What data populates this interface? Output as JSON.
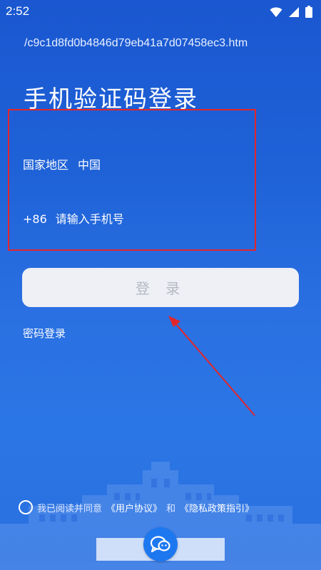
{
  "status_bar": {
    "time": "2:52",
    "icons": [
      "wifi-icon",
      "signal-icon",
      "battery-icon"
    ]
  },
  "url_text": "/c9c1d8fd0b4846d79eb41a7d07458ec3.htm",
  "page_title": "手机验证码登录",
  "region": {
    "label": "国家地区",
    "value": "中国"
  },
  "phone": {
    "country_code": "+86",
    "placeholder": "请输入手机号"
  },
  "login_button_label": "登 录",
  "password_login_label": "密码登录",
  "agreement": {
    "prefix": "我已阅读并同意",
    "user_agreement": "《用户协议》",
    "conjunction": "和",
    "privacy_policy": "《隐私政策指引》"
  },
  "social_login": {
    "icon": "wechat-icon"
  },
  "colors": {
    "background_top": "#1a57d0",
    "background_bottom": "#2b76e6",
    "highlight_box": "#e3262a",
    "login_button_bg": "#eef0f6",
    "login_button_text": "#b5b8c2",
    "wechat_button": "#1d78f0"
  }
}
